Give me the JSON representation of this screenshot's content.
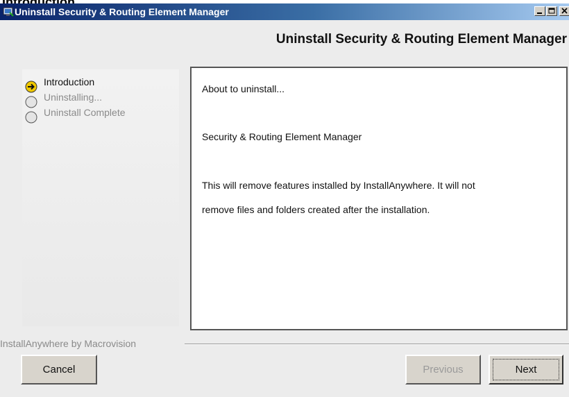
{
  "page_heading": "Introduction",
  "window": {
    "title": "Uninstall Security & Routing Element Manager",
    "controls": {
      "minimize_icon": "minimize-icon",
      "maximize_icon": "maximize-icon",
      "close_icon": "close-icon"
    }
  },
  "installer": {
    "heading": "Uninstall Security & Routing Element Manager",
    "steps": [
      {
        "label": "Introduction",
        "state": "current",
        "icon": "arrow-right-icon"
      },
      {
        "label": "Uninstalling...",
        "state": "pending",
        "icon": "radio-empty-icon"
      },
      {
        "label": "Uninstall Complete",
        "state": "pending",
        "icon": "radio-empty-icon"
      }
    ],
    "main": {
      "line1": "About to uninstall...",
      "line2": "Security & Routing Element Manager",
      "line3": "This will remove features installed by InstallAnywhere.  It will not",
      "line4": "remove files and folders created after the installation."
    },
    "brand": "InstallAnywhere by Macrovision",
    "buttons": {
      "cancel": "Cancel",
      "previous": "Previous",
      "next": "Next"
    }
  },
  "colors": {
    "titlebar_start": "#0a246a",
    "titlebar_end": "#a6caf0",
    "current_step_marker": "#f0c800",
    "disabled_text": "#9a9a9a"
  }
}
